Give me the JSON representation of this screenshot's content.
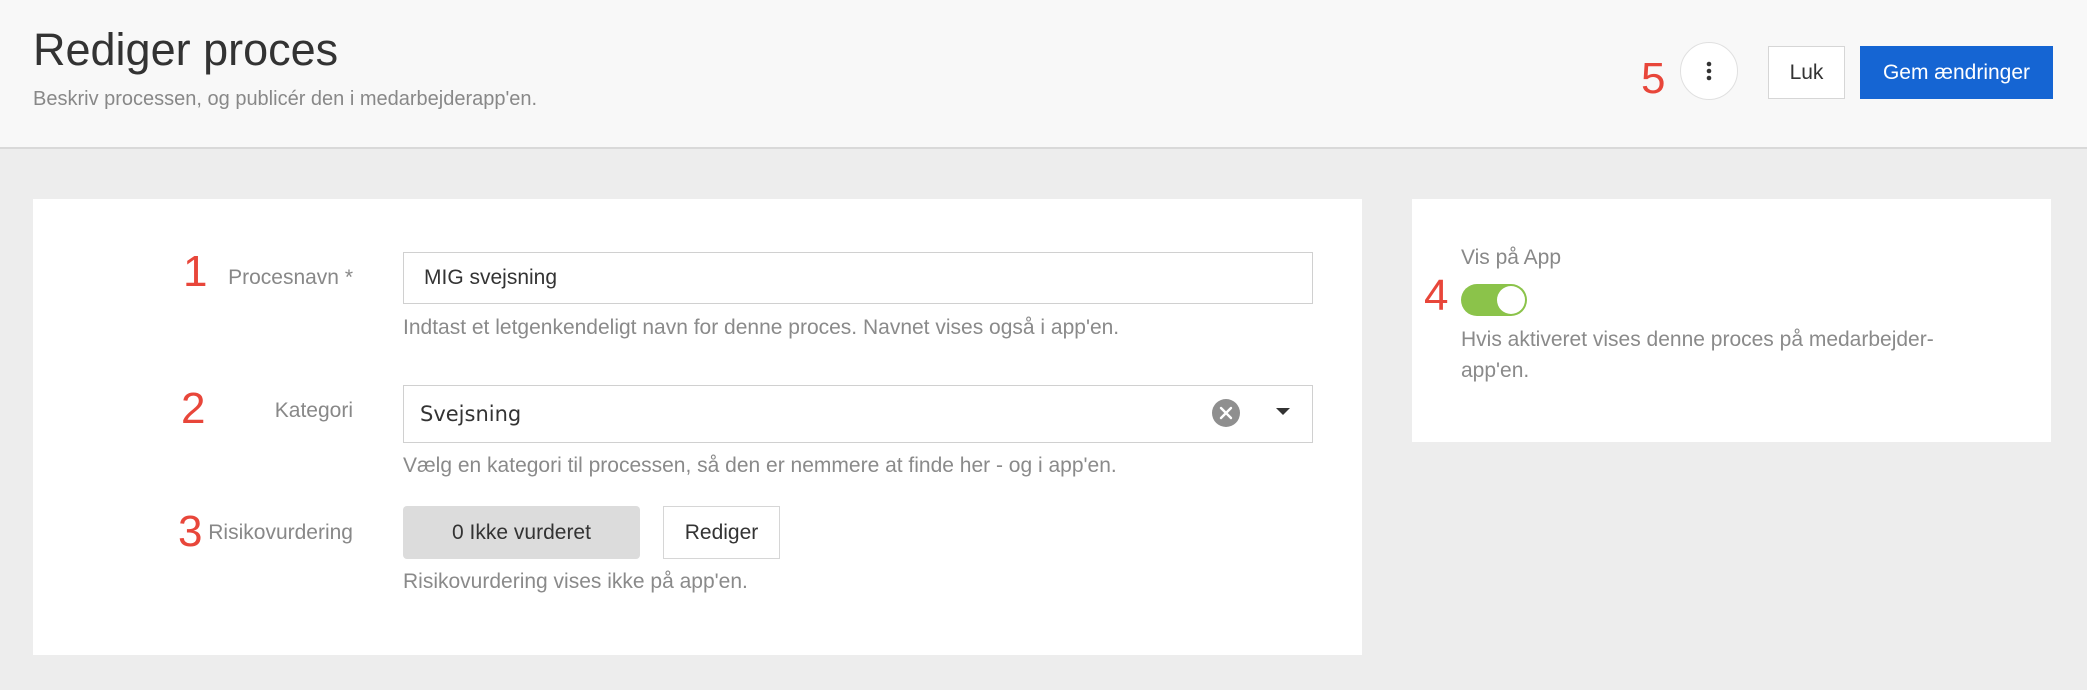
{
  "header": {
    "title": "Rediger proces",
    "subtitle": "Beskriv processen, og publicér den i medarbejderapp'en.",
    "close_label": "Luk",
    "save_label": "Gem ændringer",
    "more_icon": "more-vertical-icon"
  },
  "markers": [
    "1",
    "2",
    "3",
    "4",
    "5"
  ],
  "form": {
    "name": {
      "label": "Procesnavn *",
      "value": "MIG svejsning",
      "help": "Indtast et letgenkendeligt navn for denne proces. Navnet vises også i app'en."
    },
    "category": {
      "label": "Kategori",
      "value": "Svejsning",
      "help": "Vælg en kategori til processen, så den er nemmere at finde her - og i app'en."
    },
    "risk": {
      "label": "Risikovurdering",
      "value": "0 Ikke vurderet",
      "edit_label": "Rediger",
      "help": "Risikovurdering vises ikke på app'en."
    }
  },
  "side": {
    "label": "Vis på App",
    "toggle_on": true,
    "help": "Hvis aktiveret vises denne proces på medarbejder-app'en."
  },
  "colors": {
    "primary": "#1565d3",
    "marker": "#e8463a",
    "toggle": "#8bc34a"
  }
}
